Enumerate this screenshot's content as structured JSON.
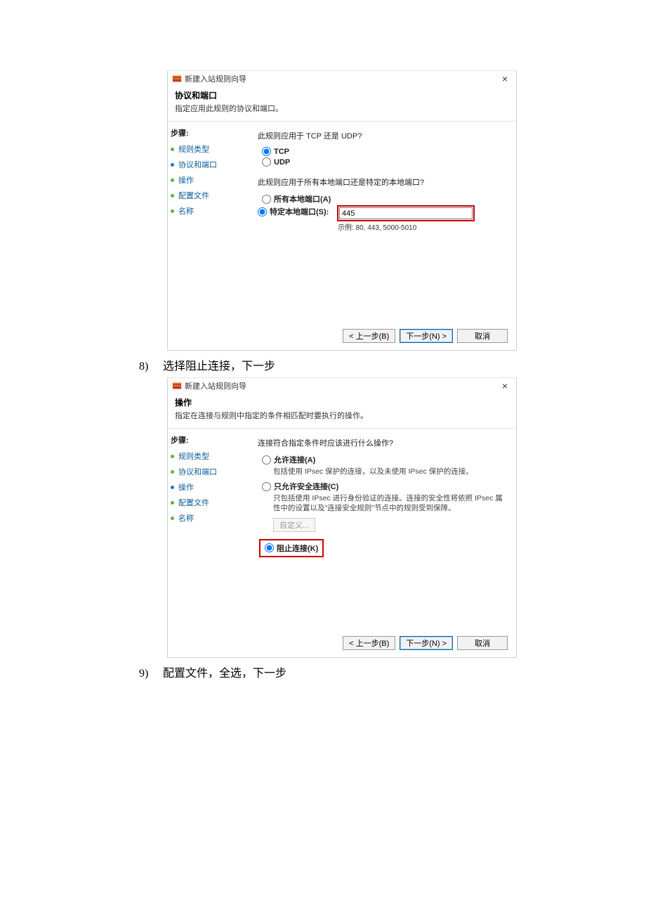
{
  "dialog1": {
    "window_title": "新建入站规则向导",
    "header_title": "协议和端口",
    "header_sub": "指定应用此规则的协议和端口。",
    "steps_label": "步骤:",
    "steps": [
      {
        "label": "规则类型"
      },
      {
        "label": "协议和端口"
      },
      {
        "label": "操作"
      },
      {
        "label": "配置文件"
      },
      {
        "label": "名称"
      }
    ],
    "q1": "此规则应用于 TCP 还是 UDP?",
    "opt_tcp": "TCP",
    "opt_udp": "UDP",
    "q2": "此规则应用于所有本地端口还是特定的本地端口?",
    "opt_all_ports": "所有本地端口(A)",
    "opt_specific_ports": "特定本地端口(S):",
    "port_value": "445",
    "port_hint": "示例: 80, 443, 5000-5010",
    "btn_back": "< 上一步(B)",
    "btn_next": "下一步(N) >",
    "btn_cancel": "取消"
  },
  "caption1_num": "8)",
  "caption1_text": "选择阻止连接，下一步",
  "dialog2": {
    "window_title": "新建入站规则向导",
    "header_title": "操作",
    "header_sub": "指定在连接与规则中指定的条件相匹配时要执行的操作。",
    "steps_label": "步骤:",
    "steps": [
      {
        "label": "规则类型"
      },
      {
        "label": "协议和端口"
      },
      {
        "label": "操作"
      },
      {
        "label": "配置文件"
      },
      {
        "label": "名称"
      }
    ],
    "q1": "连接符合指定条件时应该进行什么操作?",
    "opt_allow": "允许连接(A)",
    "opt_allow_desc": "包括使用 IPsec 保护的连接，以及未使用 IPsec 保护的连接。",
    "opt_secure": "只允许安全连接(C)",
    "opt_secure_desc": "只包括使用 IPsec 进行身份验证的连接。连接的安全性将依照 IPsec 属性中的设置以及\"连接安全规则\"节点中的规则受到保障。",
    "btn_customize": "自定义...",
    "opt_block": "阻止连接(K)",
    "btn_back": "< 上一步(B)",
    "btn_next": "下一步(N) >",
    "btn_cancel": "取消"
  },
  "caption2_num": "9)",
  "caption2_text": "配置文件，全选，下一步"
}
